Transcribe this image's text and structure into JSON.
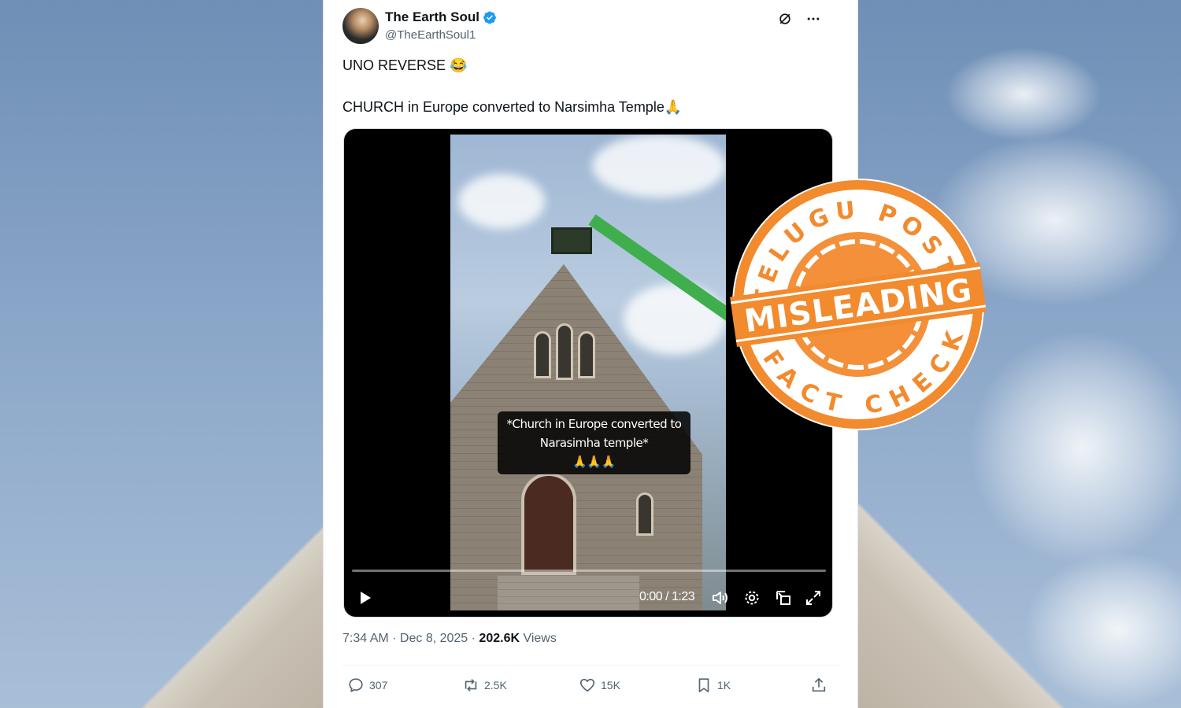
{
  "post": {
    "author": {
      "display_name": "The Earth Soul",
      "handle": "@TheEarthSoul1",
      "verified": true
    },
    "text_line_1": "UNO REVERSE 😂",
    "text_line_2": "CHURCH in Europe converted to Narsimha Temple🙏",
    "video": {
      "caption_line_1": "*Church in Europe converted to",
      "caption_line_2": "Narasimha temple*",
      "caption_line_3": "🙏🙏🙏",
      "time_display": "0:00 / 1:23",
      "progress": 0
    },
    "timestamp": "7:34 AM · Dec 8, 2025 · ",
    "views_count": "202.6K",
    "views_label": " Views",
    "actions": {
      "replies": "307",
      "reposts": "2.5K",
      "likes": "15K",
      "bookmarks": "1K"
    }
  },
  "stamp": {
    "top_text": "TELUGU POST",
    "center_text": "MISLEADING",
    "bottom_text": "FACT CHECK",
    "color": "#f28a2e"
  },
  "colors": {
    "verified": "#1d9bf0",
    "text_primary": "#0f1419",
    "text_secondary": "#536471"
  }
}
